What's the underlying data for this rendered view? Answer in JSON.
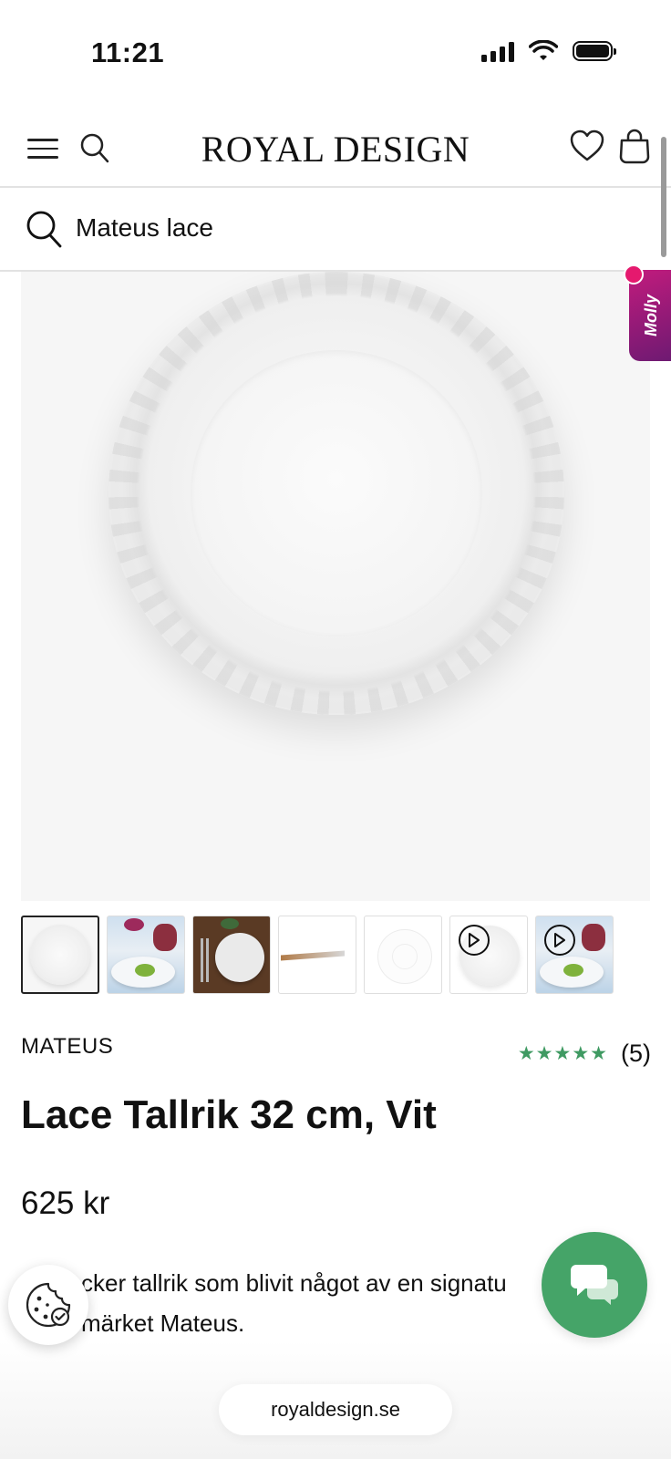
{
  "status_bar": {
    "time": "11:21"
  },
  "header": {
    "logo": "ROYAL DESIGN"
  },
  "search": {
    "query": "Mateus lace"
  },
  "molly_tab": {
    "label": "Molly"
  },
  "product": {
    "brand": "MATEUS",
    "rating": {
      "stars": "★★★★★",
      "count": "(5)",
      "star_color": "#3f9a62"
    },
    "title": "Lace Tallrik 32 cm, Vit",
    "price": "625 kr",
    "description": "En vacker tallrik som blivit något av en signatur för märket Mateus.",
    "description_visible_line1": "cker tallrik som blivit något av en signatu",
    "description_visible_line2": "märket Mateus."
  },
  "thumbnails": [
    {
      "name": "thumb-plate-front",
      "video": false
    },
    {
      "name": "thumb-lifestyle-table",
      "video": false
    },
    {
      "name": "thumb-lifestyle-dark",
      "video": false
    },
    {
      "name": "thumb-plate-side",
      "video": false
    },
    {
      "name": "thumb-plate-light",
      "video": false
    },
    {
      "name": "thumb-video-plate",
      "video": true
    },
    {
      "name": "thumb-video-lifestyle",
      "video": true
    }
  ],
  "browser": {
    "url": "royaldesign.se"
  },
  "colors": {
    "chat_green": "#45a468",
    "molly_magenta": "#c21b7d",
    "star_green": "#3f9a62"
  }
}
